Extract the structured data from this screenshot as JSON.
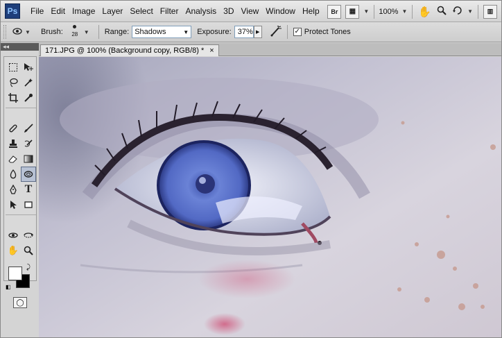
{
  "app": {
    "logo": "Ps"
  },
  "menu": [
    "File",
    "Edit",
    "Image",
    "Layer",
    "Select",
    "Filter",
    "Analysis",
    "3D",
    "View",
    "Window",
    "Help"
  ],
  "menubar_right": {
    "bridge": "Br",
    "zoom": "100%"
  },
  "options": {
    "brush_label": "Brush:",
    "brush_size": "28",
    "range_label": "Range:",
    "range_value": "Shadows",
    "exposure_label": "Exposure:",
    "exposure_value": "37%",
    "protect_tones_label": "Protect Tones",
    "protect_tones_checked": true
  },
  "toolbox": {
    "collapse_glyph": "◂◂"
  },
  "document": {
    "tab_title": "171.JPG @ 100% (Background copy, RGB/8) *",
    "close_glyph": "×"
  },
  "colors": {
    "foreground": "#ffffff",
    "background": "#000000"
  },
  "icons": [
    "marquee-icon",
    "move-icon",
    "lasso-icon",
    "magic-wand-icon",
    "crop-icon",
    "eyedropper-icon",
    "healing-brush-icon",
    "brush-icon",
    "clone-stamp-icon",
    "history-brush-icon",
    "eraser-icon",
    "gradient-icon",
    "blur-icon",
    "dodge-icon",
    "pen-icon",
    "type-icon",
    "path-selection-icon",
    "rectangle-icon",
    "3d-rotate-icon",
    "3d-orbit-icon",
    "hand-icon",
    "zoom-icon"
  ]
}
